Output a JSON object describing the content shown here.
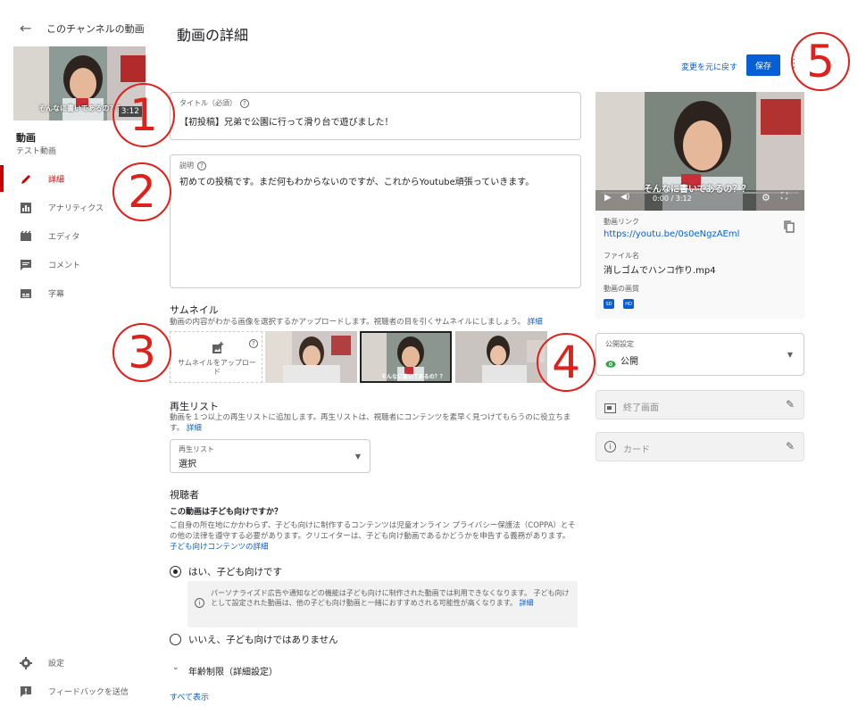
{
  "sidebar": {
    "back_title": "このチャンネルの動画",
    "thumb_caption": "そんなに書いてあるの？？",
    "thumb_duration": "3:12",
    "video_label": "動画",
    "video_sub": "テスト動画",
    "items": [
      {
        "label": "詳細",
        "icon": "pencil-icon",
        "active": true
      },
      {
        "label": "アナリティクス",
        "icon": "analytics-icon"
      },
      {
        "label": "エディタ",
        "icon": "editor-icon"
      },
      {
        "label": "コメント",
        "icon": "comment-icon"
      },
      {
        "label": "字幕",
        "icon": "subtitles-icon"
      }
    ],
    "settings_label": "設定",
    "feedback_label": "フィードバックを送信"
  },
  "header": {
    "title": "動画の詳細",
    "revert_label": "変更を元に戻す",
    "save_label": "保存"
  },
  "title_field": {
    "label": "タイトル（必須）",
    "value": "【初投稿】兄弟で公園に行って滑り台で遊びました！"
  },
  "description_field": {
    "label": "説明",
    "value": "初めての投稿です。まだ何もわからないのですが、これからYoutube頑張っていきます。"
  },
  "thumbnail": {
    "title": "サムネイル",
    "desc": "動画の内容がわかる画像を選択するかアップロードします。視聴者の目を引くサムネイルにしましょう。",
    "link": "詳細",
    "upload_label": "サムネイルをアップロード",
    "thumb_caption": "そんなに書いてあるの？？"
  },
  "playlist": {
    "title": "再生リスト",
    "desc": "動画を１つ以上の再生リストに追加します。再生リストは、視聴者にコンテンツを素早く見つけてもらうのに役立ちます。",
    "link": "詳細",
    "select_label": "再生リスト",
    "select_value": "選択"
  },
  "audience": {
    "title": "視聴者",
    "question": "この動画は子ども向けですか？",
    "desc": "ご自身の所在地にかかわらず、子ども向けに制作するコンテンツは児童オンライン プライバシー保護法（COPPA）とその他の法律を遵守する必要があります。クリエイターは、子ども向け動画であるかどうかを申告する義務があります。",
    "link": "子ども向けコンテンツの詳細",
    "yes_label": "はい、子ども向けです",
    "note": "パーソナライズド広告や通知などの機能は子ども向けに制作された動画では利用できなくなります。 子ども向けとして設定された動画は、他の子ども向け動画と一緒におすすめされる可能性が高くなります。",
    "note_link": "詳細",
    "no_label": "いいえ、子ども向けではありません",
    "yes_selected": true
  },
  "age_restriction": {
    "label": "年齢制限（詳細設定）"
  },
  "show_all": "すべて表示",
  "preview": {
    "caption": "そんなに書いてあるの？？",
    "time": "0:00 / 3:12",
    "link_label": "動画リンク",
    "link_value": "https://youtu.be/0s0eNgzAEml",
    "file_label": "ファイル名",
    "file_value": "消しゴムでハンコ作り.mp4",
    "quality_label": "動画の画質",
    "quality_badges": [
      "SD",
      "HD"
    ]
  },
  "visibility": {
    "label": "公開設定",
    "value": "公開"
  },
  "end_screen": {
    "label": "終了画面"
  },
  "cards": {
    "label": "カード"
  },
  "annotations": [
    "1",
    "2",
    "3",
    "4",
    "5"
  ],
  "colors": {
    "accent": "#065fd4",
    "active": "#cc0000",
    "annotation": "#e0201b"
  }
}
